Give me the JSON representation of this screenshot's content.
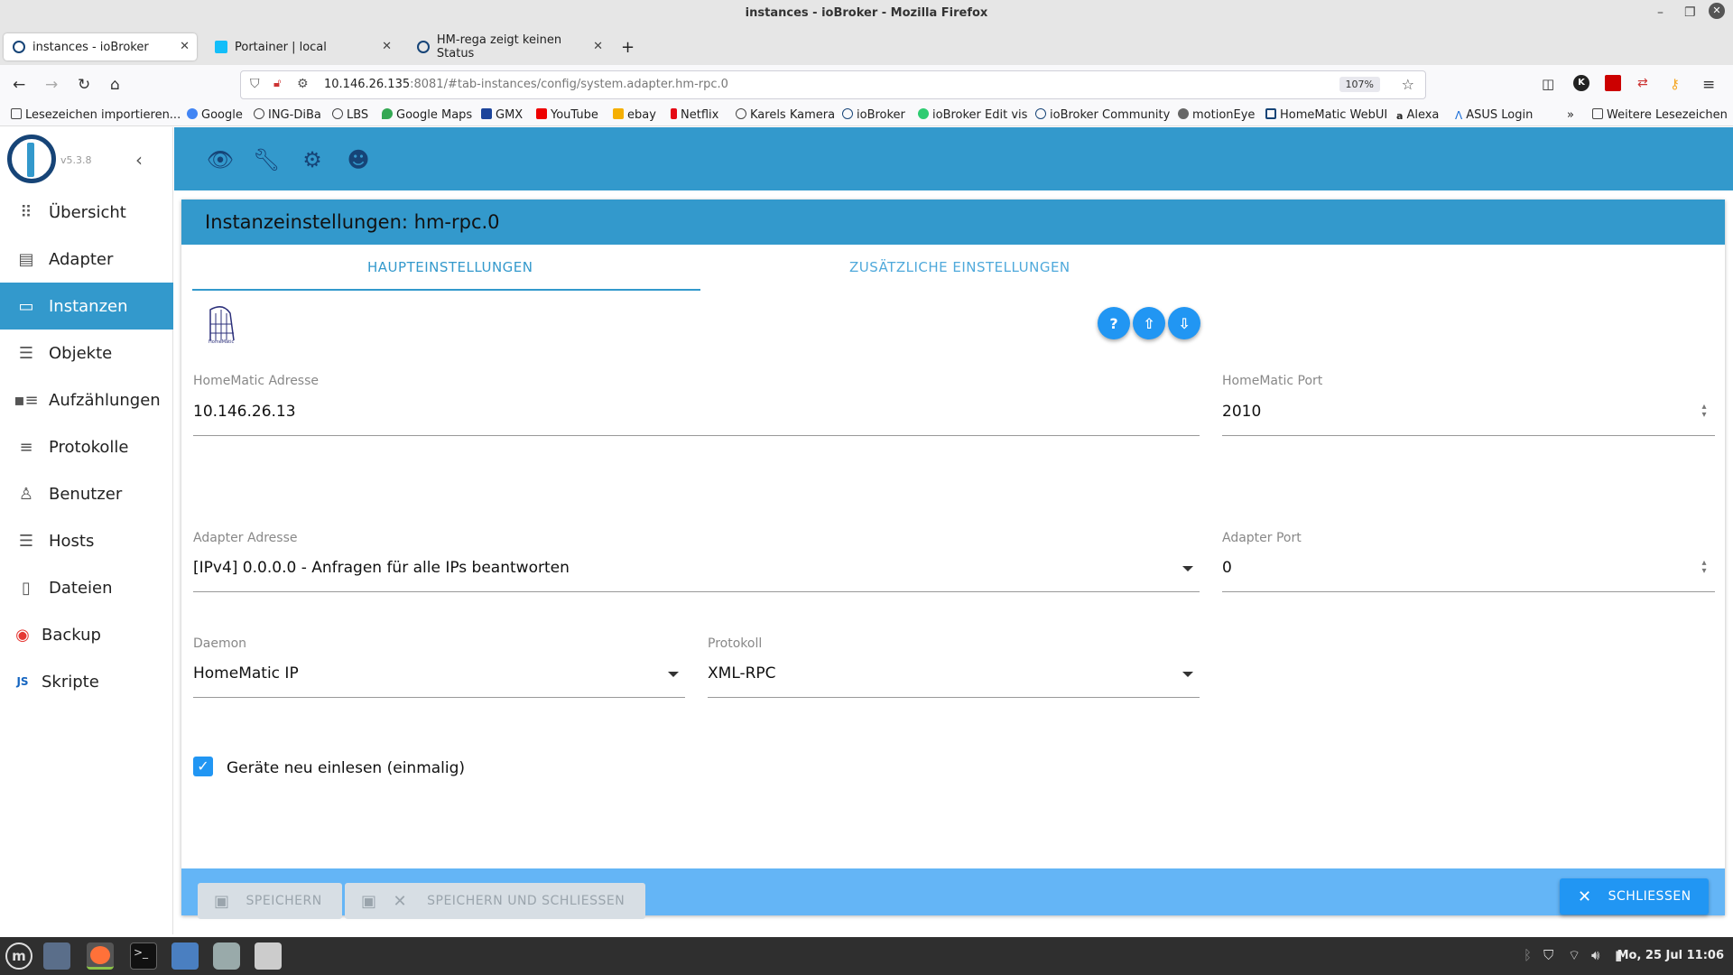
{
  "window": {
    "title": "instances - ioBroker - Mozilla Firefox"
  },
  "tabs": [
    {
      "label": "instances - ioBroker",
      "active": true
    },
    {
      "label": "Portainer | local",
      "active": false
    },
    {
      "label": "HM-rega zeigt keinen Status",
      "active": false
    }
  ],
  "urlbar": {
    "host": "10.146.26.135",
    "rest": ":8081/#tab-instances/config/system.adapter.hm-rpc.0",
    "zoom": "107%"
  },
  "bookmarks": {
    "items": [
      "Lesezeichen importieren...",
      "Google",
      "ING-DiBa",
      "LBS",
      "Google Maps",
      "GMX",
      "YouTube",
      "ebay",
      "Netflix",
      "Karels Kamera",
      "ioBroker",
      "ioBroker Edit vis",
      "ioBroker Community",
      "motionEye",
      "HomeMatic WebUI",
      "Alexa",
      "ASUS Login"
    ],
    "more": "Weitere Lesezeichen"
  },
  "app": {
    "version": "v5.3.8",
    "nav": [
      "Übersicht",
      "Adapter",
      "Instanzen",
      "Objekte",
      "Aufzählungen",
      "Protokolle",
      "Benutzer",
      "Hosts",
      "Dateien",
      "Backup",
      "Skripte"
    ],
    "active_nav": "Instanzen"
  },
  "dialog": {
    "title": "Instanzeinstellungen: hm-rpc.0",
    "tab_main": "HAUPTEINSTELLUNGEN",
    "tab_extra": "ZUSÄTZLICHE EINSTELLUNGEN",
    "logo_text": "HomeMatic",
    "fields": {
      "hm_address": {
        "label": "HomeMatic Adresse",
        "value": "10.146.26.13"
      },
      "hm_port": {
        "label": "HomeMatic Port",
        "value": "2010"
      },
      "adapter_address": {
        "label": "Adapter Adresse",
        "value": "[IPv4] 0.0.0.0 - Anfragen für alle IPs beantworten"
      },
      "adapter_port": {
        "label": "Adapter Port",
        "value": "0"
      },
      "daemon": {
        "label": "Daemon",
        "value": "HomeMatic IP"
      },
      "protocol": {
        "label": "Protokoll",
        "value": "XML-RPC"
      }
    },
    "checkbox": {
      "label": "Geräte neu einlesen (einmalig)",
      "checked": true
    },
    "buttons": {
      "save": "SPEICHERN",
      "save_close": "SPEICHERN UND SCHLIESSEN",
      "close": "SCHLIESSEN"
    }
  },
  "taskbar": {
    "clock": "Mo, 25 Jul 11:06"
  },
  "colors": {
    "primary": "#3399cc",
    "dark": "#164477",
    "accent": "#2196f3"
  }
}
